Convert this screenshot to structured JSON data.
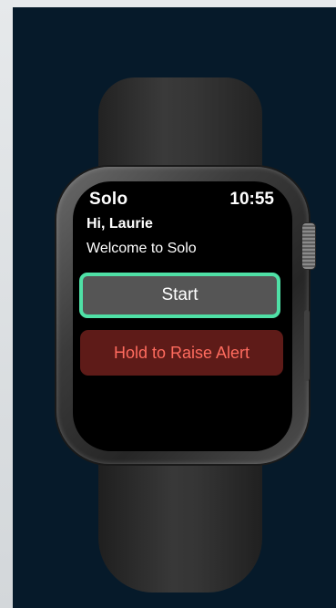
{
  "app": {
    "title": "Solo",
    "time": "10:55"
  },
  "main": {
    "greeting": "Hi, Laurie",
    "welcome": "Welcome to Solo"
  },
  "buttons": {
    "start_label": "Start",
    "alert_label": "Hold to Raise Alert"
  },
  "colors": {
    "background": "#061a2a",
    "start_border": "#4fe0a6",
    "start_fill": "#555555",
    "alert_fill": "#5e1b18",
    "alert_text": "#ff6b5e"
  }
}
